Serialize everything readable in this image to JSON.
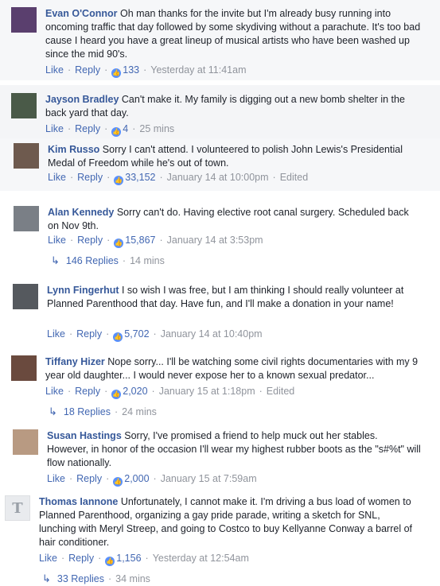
{
  "comments": [
    {
      "author": "Evan O'Connor",
      "text": "Oh man thanks for the invite but I'm already busy running into oncoming traffic that day followed by some skydiving without a parachute. It's too bad cause I heard you have a great lineup of musical artists who have been washed up since the mid 90's.",
      "like": "Like",
      "reply": "Reply",
      "reactions": "133",
      "time": "Yesterday at 11:41am",
      "edited": "",
      "avatar_color": "#5a3f6e"
    },
    {
      "author": "Jayson Bradley",
      "text": "Can't make it. My family is digging out a new bomb shelter in the back yard that day.",
      "like": "Like",
      "reply": "Reply",
      "reactions": "4",
      "time": "25 mins",
      "edited": "",
      "avatar_color": "#4a5a48"
    },
    {
      "author": "Kim Russo",
      "text": "Sorry I can't attend. I volunteered to polish John Lewis's Presidential Medal of Freedom while he's out of town.",
      "like": "Like",
      "reply": "Reply",
      "reactions": "33,152",
      "time": "January 14 at 10:00pm",
      "edited": "Edited",
      "avatar_color": "#6e5a4e"
    },
    {
      "author": "Alan Kennedy",
      "text": "Sorry can't do. Having elective root canal surgery. Scheduled back on Nov 9th.",
      "like": "Like",
      "reply": "Reply",
      "reactions": "15,867",
      "time": "January 14 at 3:53pm",
      "edited": "",
      "avatar_color": "#7a7f86",
      "replies": "146 Replies",
      "replies_time": "14 mins"
    },
    {
      "author": "Lynn Fingerhut",
      "text": "I so wish I was free, but I am thinking I should really volunteer at Planned Parenthood that day. Have fun, and I'll make a donation in your name!",
      "like": "Like",
      "reply": "Reply",
      "reactions": "5,702",
      "time": "January 14 at 10:40pm",
      "edited": "",
      "avatar_color": "#55595e"
    },
    {
      "author": "Tiffany Hizer",
      "text": "Nope sorry... I'll be watching some civil rights documentaries with my 9 year old daughter... I would never expose her to a known sexual predator...",
      "like": "Like",
      "reply": "Reply",
      "reactions": "2,020",
      "time": "January 15 at 1:18pm",
      "edited": "Edited",
      "avatar_color": "#6a4a3e",
      "replies": "18 Replies",
      "replies_time": "24 mins"
    },
    {
      "author": "Susan Hastings",
      "text": "Sorry, I've promised a friend to help muck out her stables. However, in honor of the occasion I'll wear my highest rubber boots as the \"s#%t\" will flow nationally.",
      "like": "Like",
      "reply": "Reply",
      "reactions": "2,000",
      "time": "January 15 at 7:59am",
      "edited": "",
      "avatar_color": "#b89a82"
    },
    {
      "author": "Thomas Iannone",
      "text": "Unfortunately, I cannot make it. I'm driving a bus load of women to Planned Parenthood, organizing a gay pride parade, writing a sketch for SNL, lunching with Meryl Streep, and going to Costco to buy Kellyanne Conway a barrel of hair conditioner.",
      "like": "Like",
      "reply": "Reply",
      "reactions": "1,156",
      "time": "Yesterday at 12:54am",
      "edited": "",
      "avatar_color": "#e9ebee",
      "avatar_letter": "T",
      "replies": "33 Replies",
      "replies_time": "34 mins"
    }
  ],
  "colors": {
    "link": "#365899",
    "action": "#4267b2",
    "meta": "#90949c",
    "reaction": "#5890ff"
  },
  "icons": {
    "reaction": "like-reaction-icon",
    "reply_arrow": "reply-arrow-icon"
  }
}
